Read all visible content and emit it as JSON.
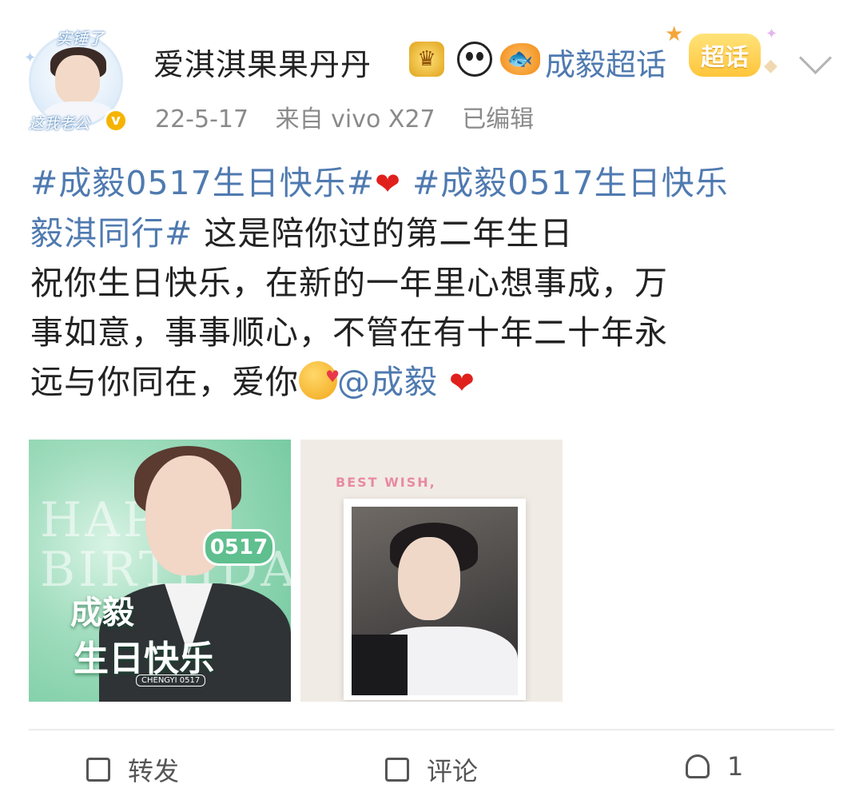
{
  "user": {
    "name": "爱淇淇果果丹丹",
    "avatar_text_top": "实锤了",
    "avatar_text_bottom": "这我老公",
    "verified_mark": "v",
    "badges": [
      "crown-badge-icon",
      "panda-icon",
      "fish-icon"
    ]
  },
  "supertopic": {
    "link": "成毅超话",
    "pill": "超话"
  },
  "meta": {
    "date": "22-5-17",
    "source": "来自 vivo X27",
    "edited": "已编辑"
  },
  "post": {
    "hashtag1": "#成毅0517生日快乐#",
    "hashtag2a": "#成毅0517生日快乐",
    "hashtag2b": "毅淇同行#",
    "line2_text": " 这是陪你过的第二年生日",
    "line3": "祝你生日快乐，在新的一年里心想事成，万",
    "line4": "事如意，事事顺心，不管在有十年二十年永",
    "line5_text": "远与你同在，爱你",
    "mention": "@成毅",
    "heart": "❤"
  },
  "images": {
    "image1": {
      "bg_text": "HAPPY\nBIRTHDAY",
      "tag": "0517",
      "title1": "成毅",
      "title2": "生日快乐",
      "small": "CHENGYI 0517"
    },
    "image2": {
      "wish": "BEST WISH,"
    }
  },
  "actions": {
    "repost": "转发",
    "comment": "评论",
    "like": "1"
  },
  "colors": {
    "link": "#4f7ab0",
    "heart": "#e0201c",
    "meta": "#8a8a8a"
  }
}
